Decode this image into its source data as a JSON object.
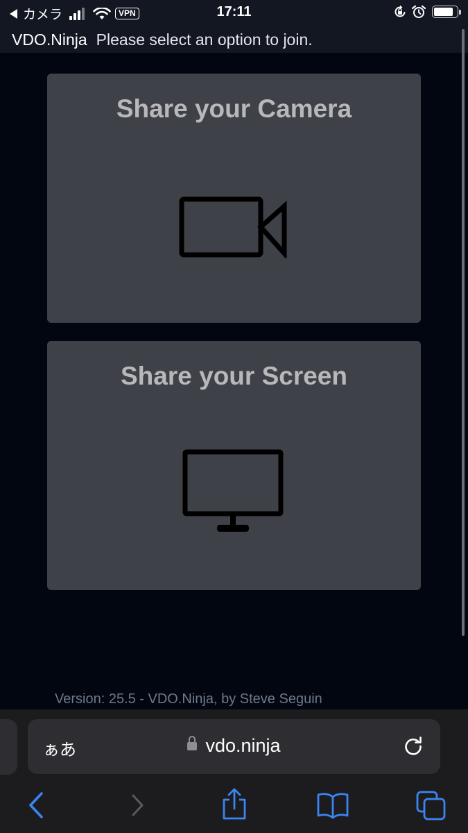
{
  "status_bar": {
    "back_app_label": "カメラ",
    "vpn_label": "VPN",
    "time": "17:11",
    "battery_level": 0.85
  },
  "title_bar": {
    "brand": "VDO.Ninja",
    "prompt": "Please select an option to join."
  },
  "options": [
    {
      "label": "Share your Camera",
      "icon": "video-camera-icon"
    },
    {
      "label": "Share your Screen",
      "icon": "monitor-icon"
    }
  ],
  "footer": {
    "version": "Version: 25.5 - VDO.Ninja, by Steve Seguin"
  },
  "browser": {
    "text_size_label": "ぁあ",
    "url": "vdo.ninja",
    "nav_icons": [
      "back-arrow-icon",
      "forward-arrow-icon",
      "share-icon",
      "bookmarks-icon",
      "tabs-icon"
    ]
  },
  "colors": {
    "accent": "#3a85f4",
    "card_bg": "#3f4148",
    "page_bg": "#020610",
    "card_title": "#b8b8bb",
    "version_text": "#6d7a8c"
  }
}
